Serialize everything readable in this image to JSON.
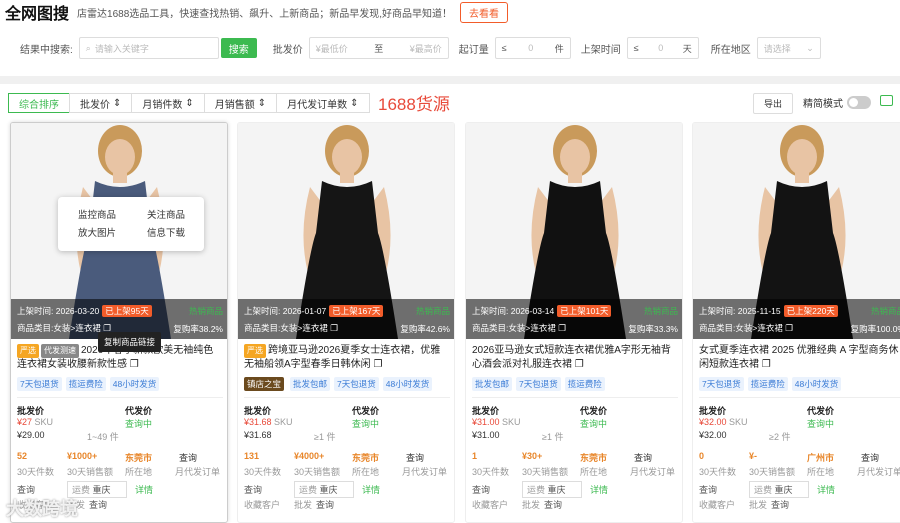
{
  "header": {
    "logo": "全网图搜",
    "tagline": "店雷达1688选品工具，快速查找热销、飙升、上新商品；新品早发现,好商品早知道！",
    "look_btn": "去看看"
  },
  "filters": {
    "search_label": "结果中搜索:",
    "search_placeholder": "请输入关键字",
    "search_btn": "搜索",
    "price_label": "批发价",
    "price_min": "¥最低价",
    "price_to": "至",
    "price_max": "¥最高价",
    "moq_label": "起订量",
    "moq_op": "≤",
    "moq_value": "0",
    "moq_unit": "件",
    "listing_label": "上架时间",
    "listing_op": "≤",
    "listing_value": "0",
    "listing_unit": "天",
    "region_label": "所在地区",
    "region_placeholder": "请选择"
  },
  "sortbar": {
    "tabs": [
      "综合排序",
      "批发价",
      "月销件数",
      "月销售额",
      "月代发订单数"
    ],
    "title": "1688货源",
    "export": "导出",
    "simple_mode": "精简模式"
  },
  "popup": {
    "monitor": "监控商品",
    "follow": "关注商品",
    "zoom": "放大图片",
    "download": "信息下载",
    "copy_link": "复制商品链接"
  },
  "common": {
    "listing_time_label": "上架时间:",
    "category_label": "商品类目:",
    "category": "女装>连衣裙",
    "repurchase_prefix": "复购率",
    "hot_label": "热销商品",
    "wholesale_label": "批发价",
    "dropship_label": "代发价",
    "sku_label": "SKU",
    "sales30_label": "30天件数",
    "revenue30_label": "30天销售额",
    "location_label": "所在地",
    "dropship_orders_label": "月代发订单",
    "query": "查询",
    "query_in": "查询中",
    "details": "详情",
    "shipping_label": "运费",
    "shipping_city": "重庆",
    "collect_label": "收藏客户",
    "batch_label": "批发"
  },
  "cards": [
    {
      "date": "2026-03-20",
      "listed": "已上架95天",
      "repurchase": "38.2%",
      "tag_a": "严选",
      "tag_b": "代发测速",
      "title": "2026年春季新款欧美无袖纯色连衣裙女装收腰新款性感",
      "tags": [
        "7天包退货",
        "揽运费险",
        "48小时发货"
      ],
      "price": "¥27",
      "dropship_price": "¥29.00",
      "moq": "1~49 件",
      "sales": "52",
      "revenue": "¥1000+",
      "city": "东莞市",
      "dress_color": "#4a5b7c"
    },
    {
      "date": "2026-01-07",
      "listed": "已上架167天",
      "repurchase": "42.6%",
      "tag_a": "严选",
      "tag_b": "",
      "title": "跨境亚马逊2026夏季女士连衣裙，优雅无袖船领A字型春季日韩休闲",
      "tags": [
        "批发包邮",
        "7天包退货",
        "48小时发货"
      ],
      "price": "¥31.68",
      "dropship_price": "¥31.68",
      "moq": "≥1 件",
      "sales": "131",
      "revenue": "¥4000+",
      "city": "东莞市",
      "dress_color": "#151515",
      "extra_tag": "镇店之宝"
    },
    {
      "date": "2026-03-14",
      "listed": "已上架101天",
      "repurchase": "33.3%",
      "tag_a": "",
      "tag_b": "",
      "title": "2026亚马逊女式短款连衣裙优雅A字形无袖背心酒会派对礼服连衣裙",
      "tags": [
        "批发包邮",
        "7天包退货",
        "揽运费险"
      ],
      "price": "¥31.00",
      "dropship_price": "¥31.00",
      "moq": "≥1 件",
      "sales": "1",
      "revenue": "¥30+",
      "city": "东莞市",
      "dress_color": "#111111"
    },
    {
      "date": "2025-11-15",
      "listed": "已上架220天",
      "repurchase": "100.0%",
      "tag_a": "",
      "tag_b": "",
      "title": "女式夏季连衣裙 2025 优雅经典 A 字型商务休闲短款连衣裙",
      "tags": [
        "7天包退货",
        "揽运费险",
        "48小时发货"
      ],
      "price": "¥32.00",
      "dropship_price": "¥32.00",
      "moq": "≥2 件",
      "sales": "0",
      "revenue": "¥-",
      "city": "广州市",
      "dress_color": "#131313"
    }
  ],
  "watermark": "大数跨境"
}
